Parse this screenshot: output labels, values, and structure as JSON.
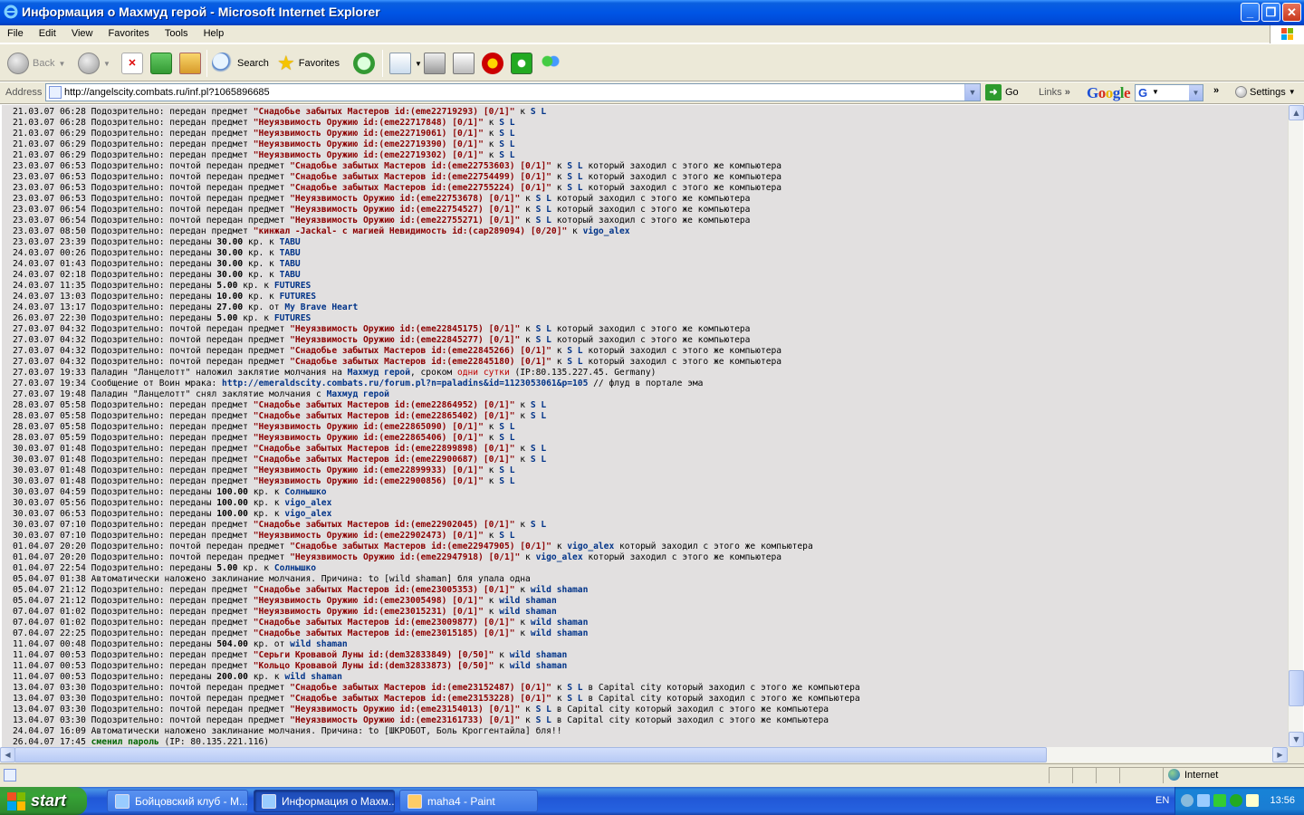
{
  "window": {
    "title": "Информация о Махмуд герой - Microsoft Internet Explorer"
  },
  "menu": [
    "File",
    "Edit",
    "View",
    "Favorites",
    "Tools",
    "Help"
  ],
  "toolbar": {
    "back": "Back",
    "search": "Search",
    "favorites": "Favorites"
  },
  "address": {
    "label": "Address",
    "url": "http://angelscity.combats.ru/inf.pl?1065896685",
    "go": "Go",
    "links": "Links"
  },
  "google": {
    "logo": "Google",
    "settings": "Settings"
  },
  "log": [
    [
      [
        "21.03.07 06:28 Подозрительно: передан предмет ",
        ""
      ],
      [
        "\"Снадобье забытых Мастеров id:(eme22719293) [0/1]\"",
        "it"
      ],
      [
        " к ",
        ""
      ],
      [
        "S L",
        "nm"
      ]
    ],
    [
      [
        "21.03.07 06:28 Подозрительно: передан предмет ",
        ""
      ],
      [
        "\"Неуязвимость Оружию id:(eme22717848) [0/1]\"",
        "it"
      ],
      [
        " к ",
        ""
      ],
      [
        "S L",
        "nm"
      ]
    ],
    [
      [
        "21.03.07 06:29 Подозрительно: передан предмет ",
        ""
      ],
      [
        "\"Неуязвимость Оружию id:(eme22719061) [0/1]\"",
        "it"
      ],
      [
        " к ",
        ""
      ],
      [
        "S L",
        "nm"
      ]
    ],
    [
      [
        "21.03.07 06:29 Подозрительно: передан предмет ",
        ""
      ],
      [
        "\"Неуязвимость Оружию id:(eme22719390) [0/1]\"",
        "it"
      ],
      [
        " к ",
        ""
      ],
      [
        "S L",
        "nm"
      ]
    ],
    [
      [
        "21.03.07 06:29 Подозрительно: передан предмет ",
        ""
      ],
      [
        "\"Неуязвимость Оружию id:(eme22719302) [0/1]\"",
        "it"
      ],
      [
        " к ",
        ""
      ],
      [
        "S L",
        "nm"
      ]
    ],
    [
      [
        "23.03.07 06:53 Подозрительно: почтой передан предмет ",
        ""
      ],
      [
        "\"Снадобье забытых Мастеров id:(eme22753603) [0/1]\"",
        "it"
      ],
      [
        " к ",
        ""
      ],
      [
        "S L",
        "nm"
      ],
      [
        " который заходил с этого же компьютера",
        ""
      ]
    ],
    [
      [
        "23.03.07 06:53 Подозрительно: почтой передан предмет ",
        ""
      ],
      [
        "\"Снадобье забытых Мастеров id:(eme22754499) [0/1]\"",
        "it"
      ],
      [
        " к ",
        ""
      ],
      [
        "S L",
        "nm"
      ],
      [
        " который заходил с этого же компьютера",
        ""
      ]
    ],
    [
      [
        "23.03.07 06:53 Подозрительно: почтой передан предмет ",
        ""
      ],
      [
        "\"Снадобье забытых Мастеров id:(eme22755224) [0/1]\"",
        "it"
      ],
      [
        " к ",
        ""
      ],
      [
        "S L",
        "nm"
      ],
      [
        " который заходил с этого же компьютера",
        ""
      ]
    ],
    [
      [
        "23.03.07 06:53 Подозрительно: почтой передан предмет ",
        ""
      ],
      [
        "\"Неуязвимость Оружию id:(eme22753678) [0/1]\"",
        "it"
      ],
      [
        " к ",
        ""
      ],
      [
        "S L",
        "nm"
      ],
      [
        " который заходил с этого же компьютера",
        ""
      ]
    ],
    [
      [
        "23.03.07 06:54 Подозрительно: почтой передан предмет ",
        ""
      ],
      [
        "\"Неуязвимость Оружию id:(eme22754527) [0/1]\"",
        "it"
      ],
      [
        " к ",
        ""
      ],
      [
        "S L",
        "nm"
      ],
      [
        " который заходил с этого же компьютера",
        ""
      ]
    ],
    [
      [
        "23.03.07 06:54 Подозрительно: почтой передан предмет ",
        ""
      ],
      [
        "\"Неуязвимость Оружию id:(eme22755271) [0/1]\"",
        "it"
      ],
      [
        " к ",
        ""
      ],
      [
        "S L",
        "nm"
      ],
      [
        " который заходил с этого же компьютера",
        ""
      ]
    ],
    [
      [
        "23.03.07 08:50 Подозрительно: передан предмет ",
        ""
      ],
      [
        "\"кинжал -Jackal- с магией Невидимость id:(cap289094) [0/20]\"",
        "it"
      ],
      [
        " к ",
        ""
      ],
      [
        "vigo_alex",
        "nm"
      ]
    ],
    [
      [
        "23.03.07 23:39 Подозрительно: переданы ",
        ""
      ],
      [
        "30.00",
        "bd"
      ],
      [
        " кр. к ",
        ""
      ],
      [
        "TABU",
        "nm"
      ]
    ],
    [
      [
        "24.03.07 00:26 Подозрительно: переданы ",
        ""
      ],
      [
        "30.00",
        "bd"
      ],
      [
        " кр. к ",
        ""
      ],
      [
        "TABU",
        "nm"
      ]
    ],
    [
      [
        "24.03.07 01:43 Подозрительно: переданы ",
        ""
      ],
      [
        "30.00",
        "bd"
      ],
      [
        " кр. к ",
        ""
      ],
      [
        "TABU",
        "nm"
      ]
    ],
    [
      [
        "24.03.07 02:18 Подозрительно: переданы ",
        ""
      ],
      [
        "30.00",
        "bd"
      ],
      [
        " кр. к ",
        ""
      ],
      [
        "TABU",
        "nm"
      ]
    ],
    [
      [
        "24.03.07 11:35 Подозрительно: переданы ",
        ""
      ],
      [
        "5.00",
        "bd"
      ],
      [
        " кр. к ",
        ""
      ],
      [
        "FUTURES",
        "nm"
      ]
    ],
    [
      [
        "24.03.07 13:03 Подозрительно: переданы ",
        ""
      ],
      [
        "10.00",
        "bd"
      ],
      [
        " кр. к ",
        ""
      ],
      [
        "FUTURES",
        "nm"
      ]
    ],
    [
      [
        "24.03.07 13:17 Подозрительно: переданы ",
        ""
      ],
      [
        "27.00",
        "bd"
      ],
      [
        " кр. от ",
        ""
      ],
      [
        "My Brave Heart",
        "nm"
      ]
    ],
    [
      [
        "26.03.07 22:30 Подозрительно: переданы ",
        ""
      ],
      [
        "5.00",
        "bd"
      ],
      [
        " кр. к ",
        ""
      ],
      [
        "FUTURES",
        "nm"
      ]
    ],
    [
      [
        "27.03.07 04:32 Подозрительно: почтой передан предмет ",
        ""
      ],
      [
        "\"Неуязвимость Оружию id:(eme22845175) [0/1]\"",
        "it"
      ],
      [
        " к ",
        ""
      ],
      [
        "S L",
        "nm"
      ],
      [
        " который заходил с этого же компьютера",
        ""
      ]
    ],
    [
      [
        "27.03.07 04:32 Подозрительно: почтой передан предмет ",
        ""
      ],
      [
        "\"Неуязвимость Оружию id:(eme22845277) [0/1]\"",
        "it"
      ],
      [
        " к ",
        ""
      ],
      [
        "S L",
        "nm"
      ],
      [
        " который заходил с этого же компьютера",
        ""
      ]
    ],
    [
      [
        "27.03.07 04:32 Подозрительно: почтой передан предмет ",
        ""
      ],
      [
        "\"Снадобье забытых Мастеров id:(eme22845266) [0/1]\"",
        "it"
      ],
      [
        " к ",
        ""
      ],
      [
        "S L",
        "nm"
      ],
      [
        " который заходил с этого же компьютера",
        ""
      ]
    ],
    [
      [
        "27.03.07 04:32 Подозрительно: почтой передан предмет ",
        ""
      ],
      [
        "\"Снадобье забытых Мастеров id:(eme22845180) [0/1]\"",
        "it"
      ],
      [
        " к ",
        ""
      ],
      [
        "S L",
        "nm"
      ],
      [
        " который заходил с этого же компьютера",
        ""
      ]
    ],
    [
      [
        "27.03.07 19:33 Паладин \"Ланцелотт\" наложил заклятие молчания на ",
        ""
      ],
      [
        "Махмуд герой",
        "nm"
      ],
      [
        ", сроком ",
        ""
      ],
      [
        "одни сутки",
        "rd"
      ],
      [
        " (IP:80.135.227.45. Germany)",
        ""
      ]
    ],
    [
      [
        "27.03.07 19:34 Сообщение от Воин мрака: ",
        ""
      ],
      [
        "http://emeraldscity.combats.ru/forum.pl?n=paladins&id=1123053061&p=105",
        "lk"
      ],
      [
        " // флуд в портале эма",
        ""
      ]
    ],
    [
      [
        "27.03.07 19:48 Паладин \"Ланцелотт\" снял заклятие молчания с ",
        ""
      ],
      [
        "Махмуд герой",
        "nm"
      ]
    ],
    [
      [
        "28.03.07 05:58 Подозрительно: передан предмет ",
        ""
      ],
      [
        "\"Снадобье забытых Мастеров id:(eme22864952) [0/1]\"",
        "it"
      ],
      [
        " к ",
        ""
      ],
      [
        "S L",
        "nm"
      ]
    ],
    [
      [
        "28.03.07 05:58 Подозрительно: передан предмет ",
        ""
      ],
      [
        "\"Снадобье забытых Мастеров id:(eme22865402) [0/1]\"",
        "it"
      ],
      [
        " к ",
        ""
      ],
      [
        "S L",
        "nm"
      ]
    ],
    [
      [
        "28.03.07 05:58 Подозрительно: передан предмет ",
        ""
      ],
      [
        "\"Неуязвимость Оружию id:(eme22865090) [0/1]\"",
        "it"
      ],
      [
        " к ",
        ""
      ],
      [
        "S L",
        "nm"
      ]
    ],
    [
      [
        "28.03.07 05:59 Подозрительно: передан предмет ",
        ""
      ],
      [
        "\"Неуязвимость Оружию id:(eme22865406) [0/1]\"",
        "it"
      ],
      [
        " к ",
        ""
      ],
      [
        "S L",
        "nm"
      ]
    ],
    [
      [
        "30.03.07 01:48 Подозрительно: передан предмет ",
        ""
      ],
      [
        "\"Снадобье забытых Мастеров id:(eme22899898) [0/1]\"",
        "it"
      ],
      [
        " к ",
        ""
      ],
      [
        "S L",
        "nm"
      ]
    ],
    [
      [
        "30.03.07 01:48 Подозрительно: передан предмет ",
        ""
      ],
      [
        "\"Снадобье забытых Мастеров id:(eme22900687) [0/1]\"",
        "it"
      ],
      [
        " к ",
        ""
      ],
      [
        "S L",
        "nm"
      ]
    ],
    [
      [
        "30.03.07 01:48 Подозрительно: передан предмет ",
        ""
      ],
      [
        "\"Неуязвимость Оружию id:(eme22899933) [0/1]\"",
        "it"
      ],
      [
        " к ",
        ""
      ],
      [
        "S L",
        "nm"
      ]
    ],
    [
      [
        "30.03.07 01:48 Подозрительно: передан предмет ",
        ""
      ],
      [
        "\"Неуязвимость Оружию id:(eme22900856) [0/1]\"",
        "it"
      ],
      [
        " к ",
        ""
      ],
      [
        "S L",
        "nm"
      ]
    ],
    [
      [
        "30.03.07 04:59 Подозрительно: переданы ",
        ""
      ],
      [
        "100.00",
        "bd"
      ],
      [
        " кр. к ",
        ""
      ],
      [
        "Солнышко",
        "nm"
      ]
    ],
    [
      [
        "30.03.07 05:56 Подозрительно: переданы ",
        ""
      ],
      [
        "100.00",
        "bd"
      ],
      [
        " кр. к ",
        ""
      ],
      [
        "vigo_alex",
        "nm"
      ]
    ],
    [
      [
        "30.03.07 06:53 Подозрительно: переданы ",
        ""
      ],
      [
        "100.00",
        "bd"
      ],
      [
        " кр. к ",
        ""
      ],
      [
        "vigo_alex",
        "nm"
      ]
    ],
    [
      [
        "30.03.07 07:10 Подозрительно: передан предмет ",
        ""
      ],
      [
        "\"Снадобье забытых Мастеров id:(eme22902045) [0/1]\"",
        "it"
      ],
      [
        " к ",
        ""
      ],
      [
        "S L",
        "nm"
      ]
    ],
    [
      [
        "30.03.07 07:10 Подозрительно: передан предмет ",
        ""
      ],
      [
        "\"Неуязвимость Оружию id:(eme22902473) [0/1]\"",
        "it"
      ],
      [
        " к ",
        ""
      ],
      [
        "S L",
        "nm"
      ]
    ],
    [
      [
        "01.04.07 20:20 Подозрительно: почтой передан предмет ",
        ""
      ],
      [
        "\"Снадобье забытых Мастеров id:(eme22947905) [0/1]\"",
        "it"
      ],
      [
        " к ",
        ""
      ],
      [
        "vigo_alex",
        "nm"
      ],
      [
        " который заходил с этого же компьютера",
        ""
      ]
    ],
    [
      [
        "01.04.07 20:20 Подозрительно: почтой передан предмет ",
        ""
      ],
      [
        "\"Неуязвимость Оружию id:(eme22947918) [0/1]\"",
        "it"
      ],
      [
        " к ",
        ""
      ],
      [
        "vigo_alex",
        "nm"
      ],
      [
        " который заходил с этого же компьютера",
        ""
      ]
    ],
    [
      [
        "01.04.07 22:54 Подозрительно: переданы ",
        ""
      ],
      [
        "5.00",
        "bd"
      ],
      [
        " кр. к ",
        ""
      ],
      [
        "Солнышко",
        "nm"
      ]
    ],
    [
      [
        "05.04.07 01:38 Автоматически наложено заклинание молчания. Причина: to [wild shaman] бля упала одна",
        ""
      ]
    ],
    [
      [
        "05.04.07 21:12 Подозрительно: передан предмет ",
        ""
      ],
      [
        "\"Снадобье забытых Мастеров id:(eme23005353) [0/1]\"",
        "it"
      ],
      [
        " к ",
        ""
      ],
      [
        "wild shaman",
        "nm"
      ]
    ],
    [
      [
        "05.04.07 21:12 Подозрительно: передан предмет ",
        ""
      ],
      [
        "\"Неуязвимость Оружию id:(eme23005498) [0/1]\"",
        "it"
      ],
      [
        " к ",
        ""
      ],
      [
        "wild shaman",
        "nm"
      ]
    ],
    [
      [
        "07.04.07 01:02 Подозрительно: передан предмет ",
        ""
      ],
      [
        "\"Неуязвимость Оружию id:(eme23015231) [0/1]\"",
        "it"
      ],
      [
        " к ",
        ""
      ],
      [
        "wild shaman",
        "nm"
      ]
    ],
    [
      [
        "07.04.07 01:02 Подозрительно: передан предмет ",
        ""
      ],
      [
        "\"Снадобье забытых Мастеров id:(eme23009877) [0/1]\"",
        "it"
      ],
      [
        " к ",
        ""
      ],
      [
        "wild shaman",
        "nm"
      ]
    ],
    [
      [
        "07.04.07 22:25 Подозрительно: передан предмет ",
        ""
      ],
      [
        "\"Снадобье забытых Мастеров id:(eme23015185) [0/1]\"",
        "it"
      ],
      [
        " к ",
        ""
      ],
      [
        "wild shaman",
        "nm"
      ]
    ],
    [
      [
        "11.04.07 00:48 Подозрительно: переданы ",
        ""
      ],
      [
        "504.00",
        "bd"
      ],
      [
        " кр. от ",
        ""
      ],
      [
        "wild shaman",
        "nm"
      ]
    ],
    [
      [
        "11.04.07 00:53 Подозрительно: передан предмет ",
        ""
      ],
      [
        "\"Серьги Кровавой Луны id:(dem32833849) [0/50]\"",
        "it"
      ],
      [
        " к ",
        ""
      ],
      [
        "wild shaman",
        "nm"
      ]
    ],
    [
      [
        "11.04.07 00:53 Подозрительно: передан предмет ",
        ""
      ],
      [
        "\"Кольцо Кровавой Луны id:(dem32833873) [0/50]\"",
        "it"
      ],
      [
        " к ",
        ""
      ],
      [
        "wild shaman",
        "nm"
      ]
    ],
    [
      [
        "11.04.07 00:53 Подозрительно: переданы ",
        ""
      ],
      [
        "200.00",
        "bd"
      ],
      [
        " кр. к ",
        ""
      ],
      [
        "wild shaman",
        "nm"
      ]
    ],
    [
      [
        "13.04.07 03:30 Подозрительно: почтой передан предмет ",
        ""
      ],
      [
        "\"Снадобье забытых Мастеров id:(eme23152487) [0/1]\"",
        "it"
      ],
      [
        " к ",
        ""
      ],
      [
        "S L",
        "nm"
      ],
      [
        " в Capital city который заходил с этого же компьютера",
        ""
      ]
    ],
    [
      [
        "13.04.07 03:30 Подозрительно: почтой передан предмет ",
        ""
      ],
      [
        "\"Снадобье забытых Мастеров id:(eme23153228) [0/1]\"",
        "it"
      ],
      [
        " к ",
        ""
      ],
      [
        "S L",
        "nm"
      ],
      [
        " в Capital city который заходил с этого же компьютера",
        ""
      ]
    ],
    [
      [
        "13.04.07 03:30 Подозрительно: почтой передан предмет ",
        ""
      ],
      [
        "\"Неуязвимость Оружию id:(eme23154013) [0/1]\"",
        "it"
      ],
      [
        " к ",
        ""
      ],
      [
        "S L",
        "nm"
      ],
      [
        " в Capital city который заходил с этого же компьютера",
        ""
      ]
    ],
    [
      [
        "13.04.07 03:30 Подозрительно: почтой передан предмет ",
        ""
      ],
      [
        "\"Неуязвимость Оружию id:(eme23161733) [0/1]\"",
        "it"
      ],
      [
        " к ",
        ""
      ],
      [
        "S L",
        "nm"
      ],
      [
        " в Capital city который заходил с этого же компьютера",
        ""
      ]
    ],
    [
      [
        "24.04.07 16:09 Автоматически наложено заклинание молчания. Причина: to [ШКРОБОТ, Боль Кроггентайла] бля!!",
        ""
      ]
    ],
    [
      [
        "26.04.07 17:45 ",
        ""
      ],
      [
        "сменил пароль",
        "gn"
      ],
      [
        " (IP: 80.135.221.116)",
        ""
      ]
    ]
  ],
  "status": {
    "zone": "Internet"
  },
  "taskbar": {
    "start": "start",
    "tasks": [
      "Бойцовский клуб - М...",
      "Информация о Махм...",
      "maha4 - Paint"
    ],
    "lang": "EN",
    "clock": "13:56"
  }
}
